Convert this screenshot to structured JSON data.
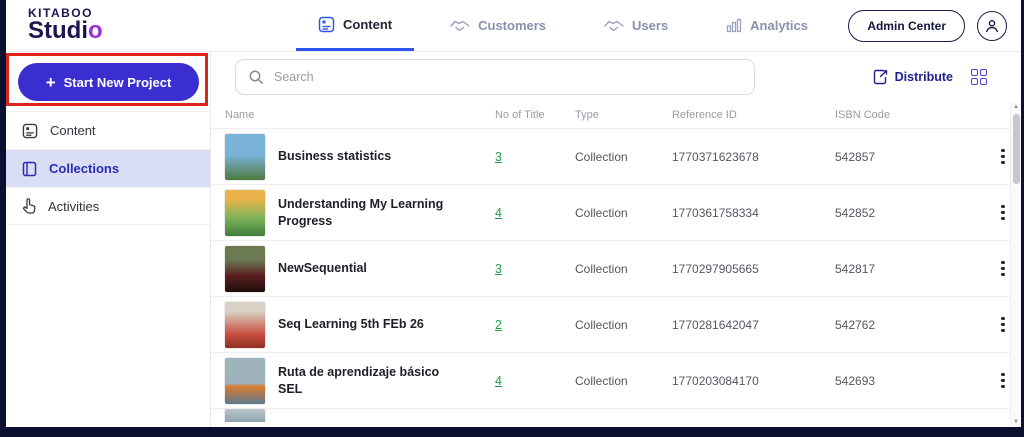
{
  "brand": {
    "top": "KITABOO",
    "bottom": "Studi",
    "accent": "o"
  },
  "nav": {
    "tabs": [
      {
        "label": "Content"
      },
      {
        "label": "Customers"
      },
      {
        "label": "Users"
      },
      {
        "label": "Analytics"
      }
    ]
  },
  "header_right": {
    "admin_center": "Admin Center"
  },
  "sidebar": {
    "plus": "+",
    "new_project": "Start New Project",
    "items": [
      {
        "label": "Content"
      },
      {
        "label": "Collections"
      },
      {
        "label": "Activities"
      }
    ]
  },
  "toolbar": {
    "search_placeholder": "Search",
    "distribute": "Distribute"
  },
  "colors": {
    "accent_button": "#3b2ed0",
    "active_tab": "#2f55ee",
    "link_green": "#1e9e4a",
    "annotation_red": "#e02318",
    "brand_accent": "#9a2fd6"
  },
  "table": {
    "columns": [
      "Name",
      "No of Title",
      "Type",
      "Reference ID",
      "ISBN Code"
    ],
    "rows": [
      {
        "name": "Business statistics",
        "titles": "3",
        "type": "Collection",
        "ref": "1770371623678",
        "isbn": "542857"
      },
      {
        "name": "Understanding My Learning Progress",
        "titles": "4",
        "type": "Collection",
        "ref": "1770361758334",
        "isbn": "542852"
      },
      {
        "name": "NewSequential",
        "titles": "3",
        "type": "Collection",
        "ref": "1770297905665",
        "isbn": "542817"
      },
      {
        "name": "Seq Learning 5th FEb 26",
        "titles": "2",
        "type": "Collection",
        "ref": "1770281642047",
        "isbn": "542762"
      },
      {
        "name": "Ruta de aprendizaje básico SEL",
        "titles": "4",
        "type": "Collection",
        "ref": "1770203084170",
        "isbn": "542693"
      }
    ]
  }
}
